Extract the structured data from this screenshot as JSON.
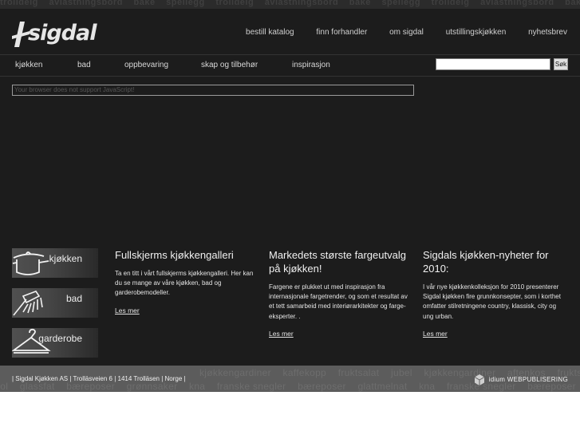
{
  "header": {
    "watermark_words": [
      "trolldeig",
      "avlastningsbord",
      "bake",
      "speilegg",
      "trolldeig",
      "avlastningsbord",
      "bake",
      "speilegg",
      "trolldeig",
      "avlastningsbord",
      "bake"
    ],
    "logo_text": "sigdal",
    "top_nav": [
      "bestill katalog",
      "finn forhandler",
      "om sigdal",
      "utstillingskjøkken",
      "nyhetsbrev"
    ]
  },
  "main_nav": {
    "items": [
      "kjøkken",
      "bad",
      "oppbevaring",
      "skap og tilbehør",
      "inspirasjon"
    ],
    "search_value": "",
    "search_button": "Søk"
  },
  "js_notice": "Your browser does not support JavaScript!",
  "tiles": [
    {
      "label": "kjøkken",
      "icon": "pot-icon"
    },
    {
      "label": "bad",
      "icon": "shower-icon"
    },
    {
      "label": "garderobe",
      "icon": "hanger-icon"
    }
  ],
  "columns": [
    {
      "title": "Fullskjerms kjøkkengalleri",
      "text": "Ta en titt i vårt fullskjerms kjøkkengalleri. Her kan du se mange av våre kjøkken, bad og garderobemodeller.",
      "more": "Les mer"
    },
    {
      "title": "Markedets største fargeutvalg på kjøkken!",
      "text": "Fargene er plukket ut med inspirasjon fra internasjonale fargetrender, og som et resultat av et tett samarbeid med interiørarkitekter og farge-eksperter. .",
      "more": "Les mer"
    },
    {
      "title": "Sigdals kjøkken-nyheter for 2010:",
      "text": "I vår nye kjøkkenkolleksjon for 2010 presenterer Sigdal kjøkken fire grunnkonsepter, som i korthet omfatter stilretningene country, klassisk, city og ung urban.",
      "more": "Les mer"
    }
  ],
  "footer": {
    "address": "| Sigdal Kjøkken AS | Trolläsveien 6 | 1414 Trolläsen | Norge |",
    "brand_strong": "idium",
    "brand_rest": "WEBPUBLISERING",
    "watermark_row1": [
      "kjøkkengardiner",
      "kaffekopp",
      "fruktsalat",
      "jubel",
      "kjøkkengardiner",
      "aftenkos",
      "fruktsalat"
    ],
    "watermark_row2": [
      "rol",
      "glassfat",
      "bæreposer",
      "grønnsaker",
      "kna",
      "franske snegler",
      "bæreposer",
      "glattmelnat",
      "kna",
      "franske snegler",
      "bæreposer"
    ]
  },
  "colors": {
    "background": "#1c1c1c",
    "footer": "#5c5c5c",
    "text": "#e4e4e4"
  }
}
